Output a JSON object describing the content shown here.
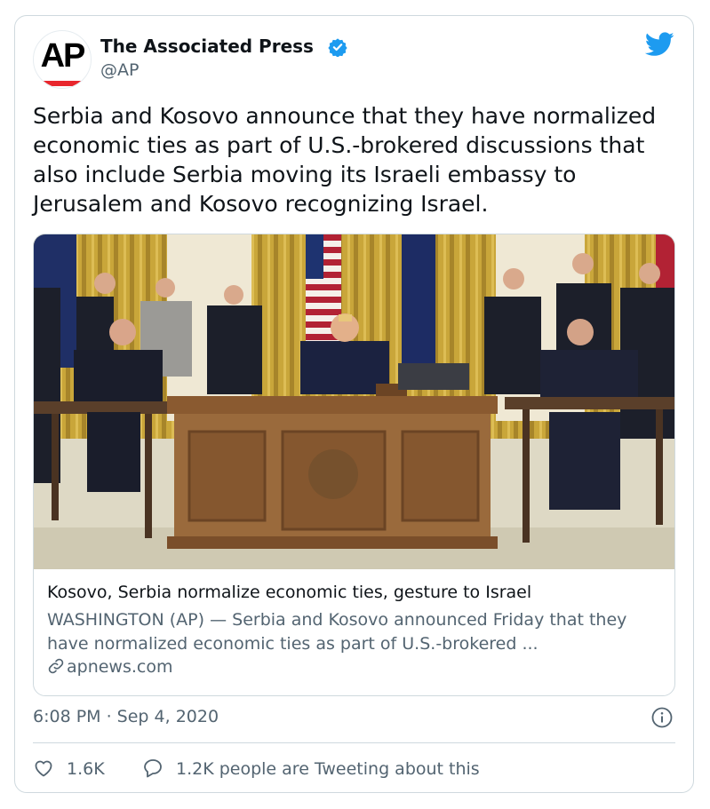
{
  "author": {
    "name": "The Associated Press",
    "handle": "@AP",
    "avatar_text": "AP",
    "verified": true
  },
  "tweet": {
    "text": "Serbia and Kosovo announce that they have normalized economic ties as part of U.S.-brokered discussions that also include Serbia moving its Israeli embassy to Jerusalem and Kosovo recognizing Israel."
  },
  "link_card": {
    "title": "Kosovo, Serbia normalize economic ties, gesture to Israel",
    "description": "WASHINGTON (AP) — Serbia and Kosovo announced Friday that they have normalized economic ties as part of U.S.-brokered ...",
    "domain": "apnews.com"
  },
  "timestamp": "6:08 PM · Sep 4, 2020",
  "actions": {
    "likes": "1.6K",
    "conversation": "1.2K people are Tweeting about this"
  },
  "colors": {
    "twitter_blue": "#1d9bf0",
    "text_secondary": "#536471",
    "border": "#cfd9de",
    "ap_red": "#e8262d"
  },
  "icons": [
    "verified-badge-icon",
    "twitter-bird-icon",
    "link-icon",
    "info-icon",
    "heart-icon",
    "speech-bubble-icon"
  ]
}
